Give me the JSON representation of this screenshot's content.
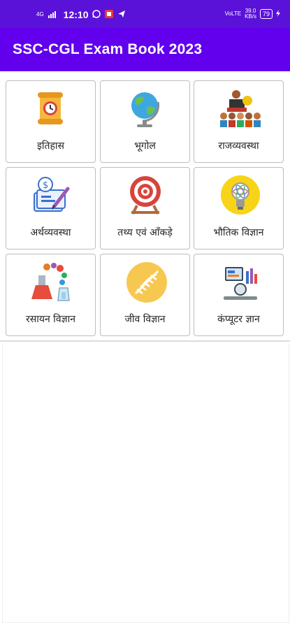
{
  "status_bar": {
    "time": "12:10",
    "network_left": "4G",
    "signal_right": "VoLTE",
    "speed_value": "39.0",
    "speed_unit": "KB/s",
    "battery": "79"
  },
  "app_bar": {
    "title": "SSC-CGL Exam Book 2023"
  },
  "tiles": [
    {
      "label": "इतिहास",
      "icon": "history-scroll-icon"
    },
    {
      "label": "भूगोल",
      "icon": "globe-icon"
    },
    {
      "label": "राजव्यवस्था",
      "icon": "polity-podium-icon"
    },
    {
      "label": "अर्थव्यवस्था",
      "icon": "economy-money-icon"
    },
    {
      "label": "तथ्य एवं आँकड़े",
      "icon": "target-facts-icon"
    },
    {
      "label": "भौतिक विज्ञान",
      "icon": "physics-bulb-icon"
    },
    {
      "label": "रसायन विज्ञान",
      "icon": "chemistry-flask-icon"
    },
    {
      "label": "जीव विज्ञान",
      "icon": "dna-icon"
    },
    {
      "label": "कंप्यूटर ज्ञान",
      "icon": "computer-icon"
    }
  ],
  "colors": {
    "status_bar": "#5a12d9",
    "app_bar": "#6200ee",
    "tile_border": "#bdbdbd"
  }
}
